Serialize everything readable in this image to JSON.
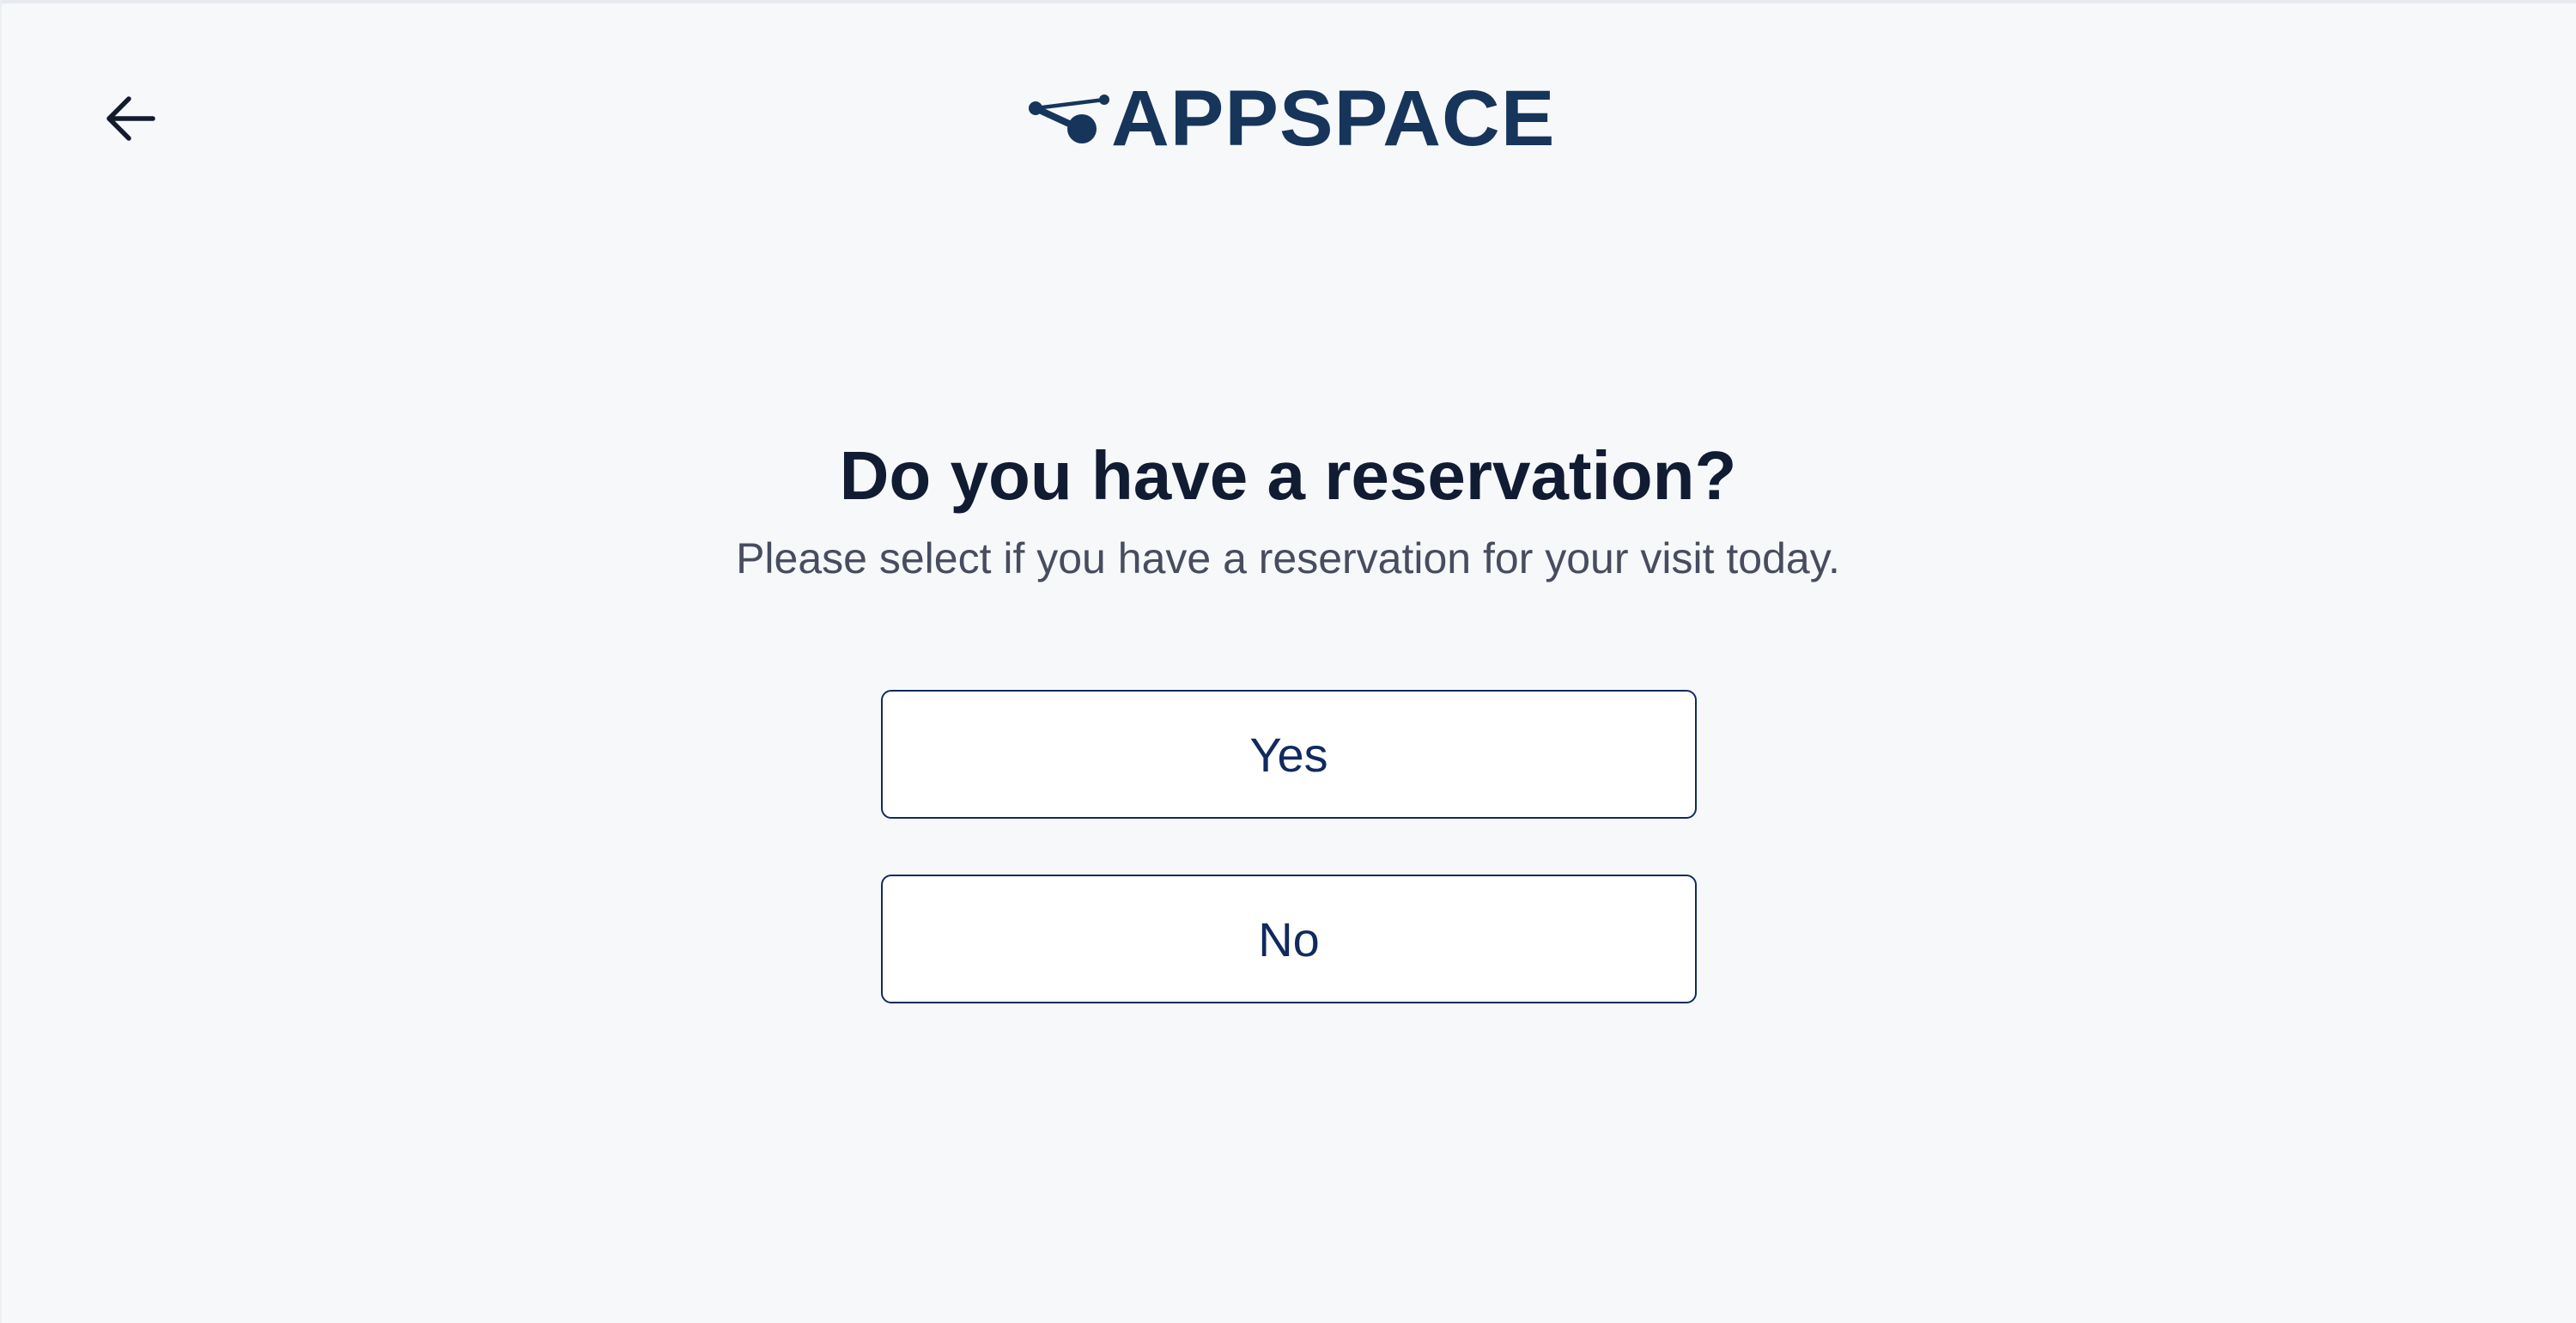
{
  "header": {
    "back_icon": "arrow-left-icon",
    "logo_text": "APPSPACE",
    "brand_color": "#17355a"
  },
  "main": {
    "title": "Do you have a reservation?",
    "subtitle": "Please select if you have a reservation for your visit today.",
    "options": [
      {
        "label": "Yes"
      },
      {
        "label": "No"
      }
    ],
    "button_border_color": "#112a5e"
  }
}
